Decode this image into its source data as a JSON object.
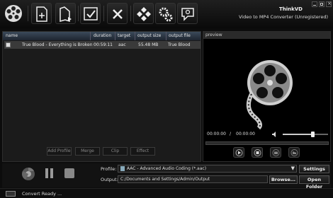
{
  "app": {
    "title": "ThinkVD",
    "subtitle": "Video to MP4 Converter (Unregistered)"
  },
  "toolbar": {
    "icons": [
      "film-reel-icon",
      "add-file-icon",
      "add-folder-icon",
      "check-icon",
      "remove-icon",
      "clips-icon",
      "settings-gears-icon",
      "help-bubble-icon"
    ]
  },
  "table": {
    "headers": [
      "name",
      "duration",
      "target",
      "output size",
      "output file"
    ],
    "rows": [
      {
        "name": "True Blood - Everything is Broken",
        "duration": "00:59:11",
        "target": "aac",
        "output_size": "55.48 MB",
        "output_file": "True Blood"
      }
    ]
  },
  "actions": [
    "Add Profile",
    "Merge",
    "Clip",
    "Effect"
  ],
  "preview": {
    "label": "preview",
    "current_time": "00:00:00",
    "separator": "/",
    "total_time": "00:00:00",
    "volume_level": 0.65
  },
  "output": {
    "profile_label": "Profile:",
    "profile_value": "AAC - Advanced Audio Coding (*.aac)",
    "settings_button": "Settings",
    "output_label": "Output:",
    "output_path": "C:/Documents and Settings/Admin/Output",
    "browse_button": "Browse...",
    "open_folder_button": "Open Folder"
  },
  "status": {
    "text": "Convert Ready ..."
  }
}
